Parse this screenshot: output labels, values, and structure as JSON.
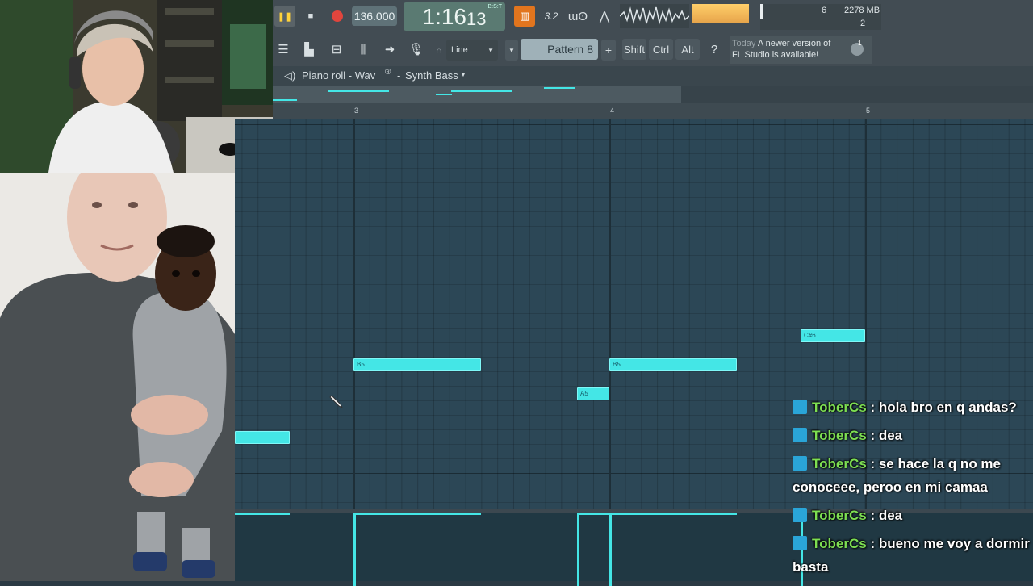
{
  "toolbar": {
    "tempo": "136.000",
    "time_main": "1:16",
    "time_sub": "13",
    "time_unit": "B:S:T",
    "pattern_label": "Pattern 8",
    "snap_label": "Line",
    "shift_label": "Shift",
    "ctrl_label": "Ctrl",
    "alt_label": "Alt",
    "cpu_value": "6",
    "ram_value": "2278 MB",
    "voices_value": "2",
    "hint_today": "Today",
    "hint_text1": "A newer version of",
    "hint_text2": "FL Studio is available!",
    "hint_badge": "1",
    "tempo_ratio_label": "3.2"
  },
  "piano_roll": {
    "title": "Piano roll - Wav",
    "channel": "Synth Bass",
    "bar_numbers": [
      "3",
      "4",
      "5"
    ],
    "notes": [
      "B5",
      "B5",
      "A5",
      "C#6"
    ]
  },
  "chat": [
    {
      "user": "ToberCs",
      "message": ": hola bro en q andas?"
    },
    {
      "user": "ToberCs",
      "message": ": dea"
    },
    {
      "user": "ToberCs",
      "message": ": se hace la q no me conoceee, peroo en mi camaa"
    },
    {
      "user": "ToberCs",
      "message": ": dea"
    },
    {
      "user": "ToberCs",
      "message": ": bueno me voy a dormir basta"
    }
  ],
  "colors": {
    "note": "#44e6e6",
    "grid_bg": "#2c4756",
    "chat_user": "#7ddf52",
    "toolbar_bg": "#424c53"
  }
}
